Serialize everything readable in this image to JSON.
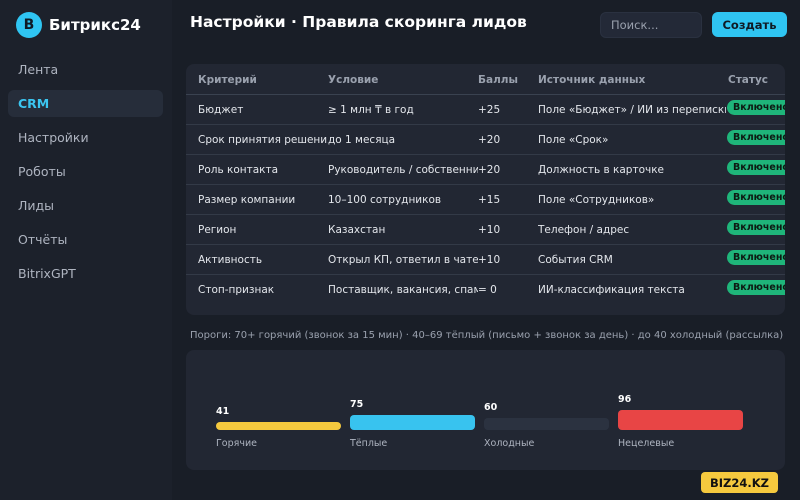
{
  "app": {
    "logo_letter": "B",
    "name": "Битрикс24"
  },
  "sidebar": {
    "items": [
      {
        "label": "Лента",
        "active": false
      },
      {
        "label": "CRM",
        "active": true
      },
      {
        "label": "Настройки",
        "active": false
      },
      {
        "label": "Роботы",
        "active": false
      },
      {
        "label": "Лиды",
        "active": false
      },
      {
        "label": "Отчёты",
        "active": false
      },
      {
        "label": "BitrixGPT",
        "active": false
      }
    ]
  },
  "header": {
    "title": "Настройки · Правила скоринга лидов",
    "search_placeholder": "Поиск...",
    "create_label": "Создать"
  },
  "table": {
    "columns": [
      "Критерий",
      "Условие",
      "Баллы",
      "Источник данных",
      "Статус"
    ],
    "rows": [
      {
        "criterion": "Бюджет",
        "condition": "≥ 1 млн ₸ в год",
        "points": "+25",
        "source": "Поле «Бюджет» / ИИ из переписки",
        "status": "Включено"
      },
      {
        "criterion": "Срок принятия решения",
        "condition": "до 1 месяца",
        "points": "+20",
        "source": "Поле «Срок»",
        "status": "Включено"
      },
      {
        "criterion": "Роль контакта",
        "condition": "Руководитель / собственник",
        "points": "+20",
        "source": "Должность в карточке",
        "status": "Включено"
      },
      {
        "criterion": "Размер компании",
        "condition": "10–100 сотрудников",
        "points": "+15",
        "source": "Поле «Сотрудников»",
        "status": "Включено"
      },
      {
        "criterion": "Регион",
        "condition": "Казахстан",
        "points": "+10",
        "source": "Телефон / адрес",
        "status": "Включено"
      },
      {
        "criterion": "Активность",
        "condition": "Открыл КП, ответил в чате",
        "points": "+10",
        "source": "События CRM",
        "status": "Включено"
      },
      {
        "criterion": "Стоп-признак",
        "condition": "Поставщик, вакансия, спам",
        "points": "= 0",
        "source": "ИИ-классификация текста",
        "status": "Включено"
      }
    ]
  },
  "thresholds_text": "Пороги: 70+ горячий (звонок за 15 мин) · 40–69 тёплый (письмо + звонок за день) · до 40 холодный (рассылка)",
  "segments": [
    {
      "label": "Горячие",
      "count": "41",
      "color": "#f5c93e"
    },
    {
      "label": "Тёплые",
      "count": "75",
      "color": "#38c3ef"
    },
    {
      "label": "Холодные",
      "count": "60",
      "color": "#2b3240"
    },
    {
      "label": "Нецелевые",
      "count": "96",
      "color": "#e84545"
    }
  ],
  "watermark": "BIZ24.KZ"
}
